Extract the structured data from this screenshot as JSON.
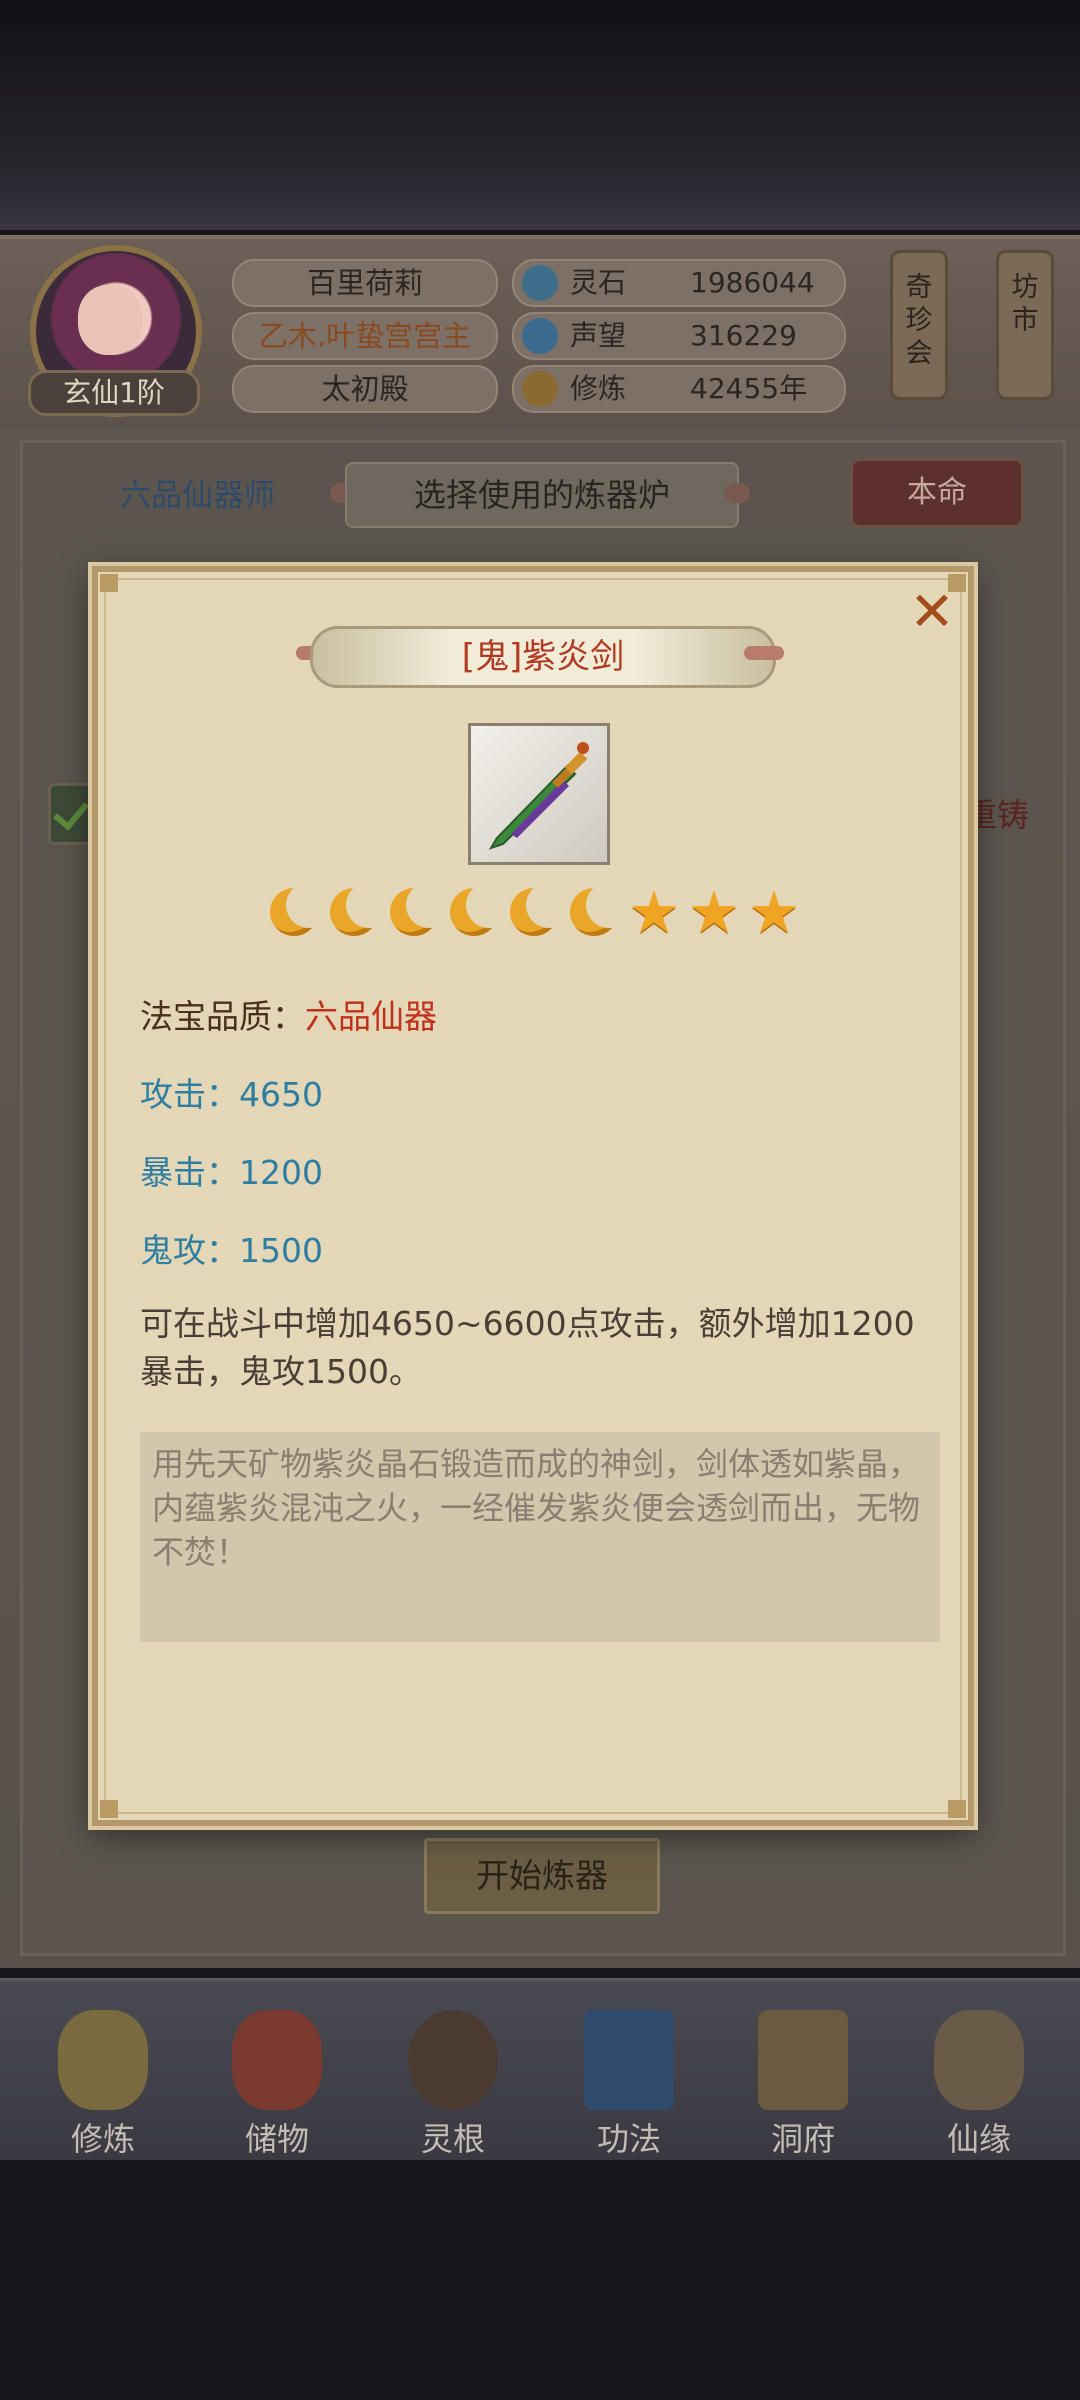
{
  "header": {
    "avatar_rank": "玄仙1阶",
    "player_name": "百里荷莉",
    "player_title": "乙木.叶蛰宫宫主",
    "location": "太初殿",
    "resources": [
      {
        "icon": "spirit-stone-icon",
        "label": "灵石",
        "value": "1986044"
      },
      {
        "icon": "reputation-icon",
        "label": "声望",
        "value": "316229"
      },
      {
        "icon": "meditation-icon",
        "label": "修炼",
        "value": "42455年"
      }
    ],
    "side_buttons": [
      "奇珍会",
      "坊市"
    ]
  },
  "forge": {
    "rank_title": "六品仙器师",
    "select_furnace": "选择使用的炼器炉",
    "benming_button": "本命",
    "recast_label": "重铸",
    "start_button": "开始炼器"
  },
  "item_modal": {
    "title": "[鬼]紫炎剑",
    "close_icon": "close-icon",
    "rating": {
      "moons": 6,
      "stars": 3
    },
    "quality_label": "法宝品质：",
    "quality_value": "六品仙器",
    "stats": [
      {
        "label": "攻击：",
        "value": "4650"
      },
      {
        "label": "暴击：",
        "value": "1200"
      },
      {
        "label": "鬼攻：",
        "value": "1500"
      }
    ],
    "effect_text": "可在战斗中增加4650~6600点攻击，额外增加1200暴击，鬼攻1500。",
    "lore_text": "用先天矿物紫炎晶石锻造而成的神剑，剑体透如紫晶，内蕴紫炎混沌之火，一经催发紫炎便会透剑而出，无物不焚！"
  },
  "bottom_nav": [
    {
      "label": "修炼",
      "icon": "cultivate-icon"
    },
    {
      "label": "储物",
      "icon": "storage-bag-icon"
    },
    {
      "label": "灵根",
      "icon": "spirit-root-icon"
    },
    {
      "label": "功法",
      "icon": "technique-book-icon"
    },
    {
      "label": "洞府",
      "icon": "cave-mansion-icon"
    },
    {
      "label": "仙缘",
      "icon": "immortal-fate-icon"
    }
  ]
}
